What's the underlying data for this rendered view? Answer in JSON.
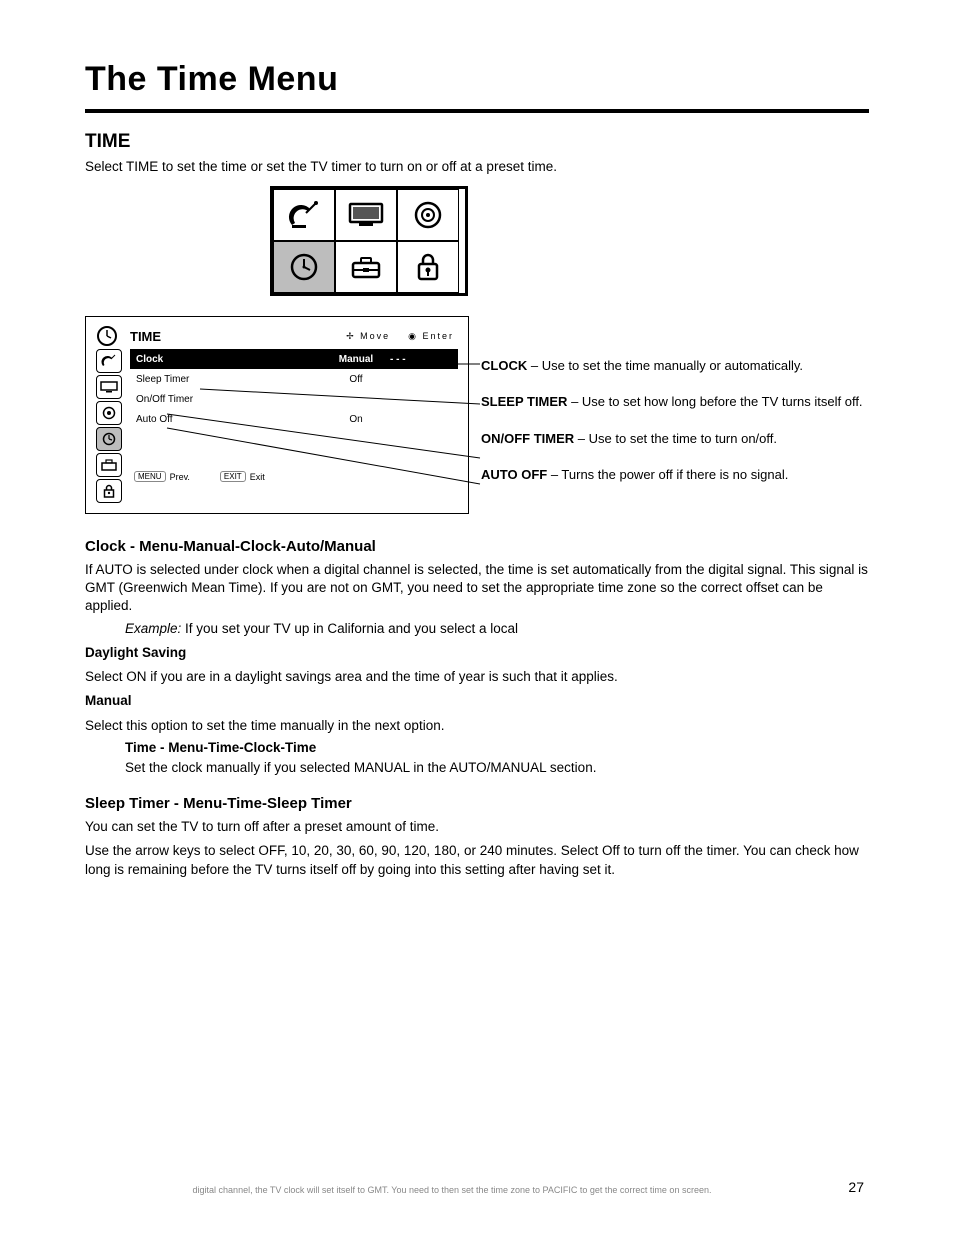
{
  "header": {
    "title": "The Time Menu",
    "section": "TIME"
  },
  "intro": "Select TIME to set the time or set the TV timer to turn on or off at a preset time.",
  "grid_icons": [
    "satellite-dish-icon",
    "tv-icon",
    "speaker-icon",
    "clock-icon",
    "toolbox-icon",
    "lock-icon"
  ],
  "menu": {
    "title": "TIME",
    "header_nav": {
      "left": "Move",
      "right": "Enter"
    },
    "side_icons": [
      "satellite-dish-icon",
      "tv-icon",
      "speaker-icon",
      "clock-icon",
      "toolbox-icon",
      "lock-icon"
    ],
    "selected_side_index": 3,
    "rows": [
      {
        "label": "Clock",
        "opt1": "Manual",
        "opt2": "- - -"
      },
      {
        "label": "Sleep Timer",
        "opt1": "Off",
        "opt2": ""
      },
      {
        "label": "On/Off Timer",
        "opt1": "",
        "opt2": ""
      },
      {
        "label": "Auto Off",
        "opt1": "On",
        "opt2": ""
      }
    ],
    "hints": [
      {
        "btn": "MENU",
        "text": "Prev."
      },
      {
        "btn": "EXIT",
        "text": "Exit"
      }
    ]
  },
  "callouts": [
    {
      "title": "CLOCK",
      "desc": "Use to set the time manually or automatically."
    },
    {
      "title": "SLEEP TIMER",
      "desc": "Use to set how long before the TV turns itself off."
    },
    {
      "title": "ON/OFF TIMER",
      "desc": "Use to set the time to turn on/off."
    },
    {
      "title": "AUTO OFF",
      "desc": "Turns the power off if there is no signal."
    }
  ],
  "clock_section": {
    "heading": "Clock - Menu-Manual-Clock-Auto/Manual",
    "text": "If AUTO is selected under clock when a digital channel is selected, the time is set automatically from the digital signal. This signal is GMT (Greenwich Mean Time). If you are not on GMT, you need to set the appropriate time zone so the correct offset can be applied.",
    "example_label": "Example:",
    "example_body": "If you set your TV up in California and you select a local",
    "daylight_title": "Daylight Saving",
    "daylight_body": "Select ON if you are in a daylight savings area and the time of year is such that it applies.",
    "manual_title": "Manual",
    "manual_body1": "Select this option to set the time manually in the next option.",
    "manual_sub": "Time - Menu-Time-Clock-Time",
    "manual_body2": "Set the clock manually if you selected MANUAL in the AUTO/MANUAL section."
  },
  "sleep_section": {
    "heading": "Sleep Timer - Menu-Time-Sleep Timer",
    "text1": "You can set the TV to turn off after a preset amount of time.",
    "text2": "Use the arrow keys to select OFF, 10, 20, 30, 60, 90, 120, 180, or 240 minutes. Select Off to turn off the timer. You can check how long is remaining before the TV turns itself off by going into this setting after having set it."
  },
  "page_number": "27",
  "footer": "digital channel, the TV clock will set itself to GMT. You need to then set the time zone to PACIFIC to get the correct time on screen."
}
